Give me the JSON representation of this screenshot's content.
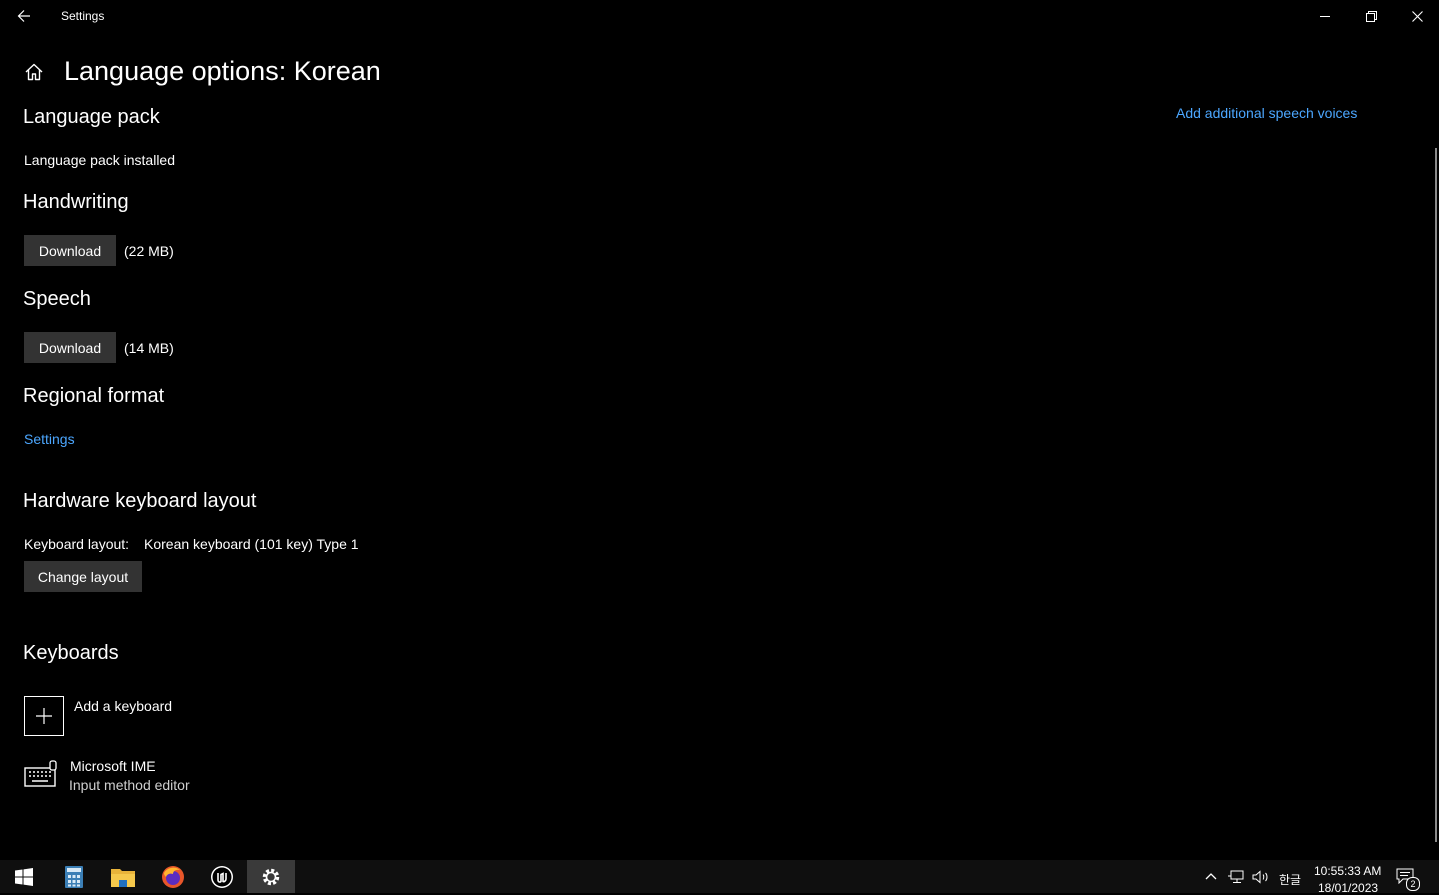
{
  "window": {
    "title": "Settings",
    "icons": {
      "back": "back-arrow-icon",
      "minimize": "minimize-icon",
      "restore": "restore-icon",
      "close": "close-icon"
    }
  },
  "page": {
    "title": "Language options: Korean",
    "home_icon": "home-icon"
  },
  "speech_voices_link": "Add additional speech voices",
  "language_pack": {
    "heading": "Language pack",
    "status": "Language pack installed"
  },
  "handwriting": {
    "heading": "Handwriting",
    "button": "Download",
    "size": "(22 MB)"
  },
  "speech": {
    "heading": "Speech",
    "button": "Download",
    "size": "(14 MB)"
  },
  "regional_format": {
    "heading": "Regional format",
    "link": "Settings"
  },
  "hardware_keyboard": {
    "heading": "Hardware keyboard layout",
    "label": "Keyboard layout:",
    "value": "Korean keyboard (101 key) Type 1",
    "button": "Change layout"
  },
  "keyboards": {
    "heading": "Keyboards",
    "add_label": "Add a keyboard",
    "items": [
      {
        "name": "Microsoft IME",
        "description": "Input method editor",
        "icon": "keyboard-icon"
      }
    ]
  },
  "taskbar": {
    "apps": [
      "start-icon",
      "calculator-icon",
      "file-explorer-icon",
      "firefox-icon",
      "unreal-engine-icon",
      "settings-gear-icon"
    ],
    "ime_indicator": "한글",
    "time": "10:55:33 AM",
    "date": "18/01/2023",
    "notification_count": "2"
  },
  "colors": {
    "background": "#000000",
    "link": "#4ca7ff",
    "button": "#333333",
    "taskbar": "#0f0f0f"
  }
}
